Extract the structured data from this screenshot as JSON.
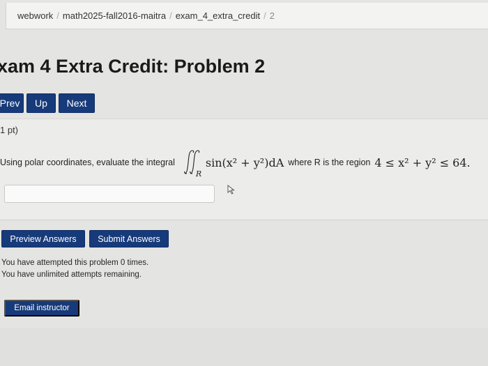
{
  "breadcrumb": {
    "items": [
      "webwork",
      "math2025-fall2016-maitra",
      "exam_4_extra_credit"
    ],
    "current": "2"
  },
  "page_title": "xam 4 Extra Credit: Problem 2",
  "nav": {
    "prev": "Prev",
    "up": "Up",
    "next": "Next"
  },
  "problem": {
    "points": "1 pt)",
    "intro": "Using polar coordinates, evaluate the integral",
    "integrand": "sin(x² + y²)dA",
    "region_sub": "R",
    "where_text": "where R is the region",
    "region": "4 ≤ x² + y² ≤ 64.",
    "answer_value": ""
  },
  "actions": {
    "preview": "Preview Answers",
    "submit": "Submit Answers"
  },
  "attempts": {
    "line1": "You have attempted this problem 0 times.",
    "line2": "You have unlimited attempts remaining."
  },
  "email_label": "Email instructor"
}
